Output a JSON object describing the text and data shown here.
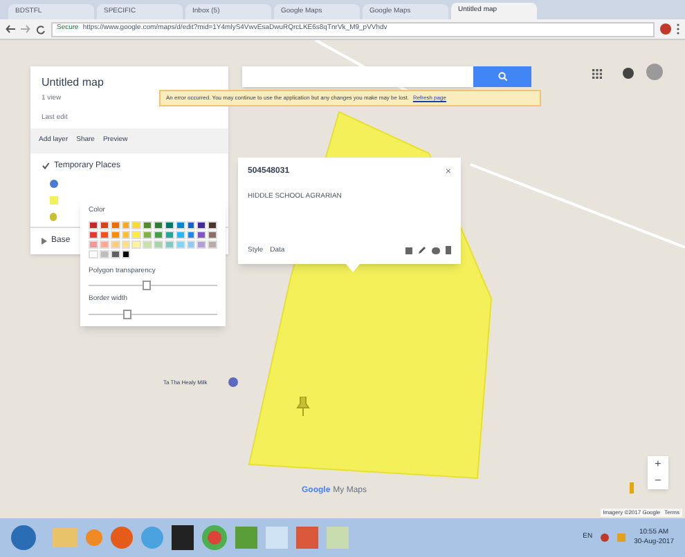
{
  "browser": {
    "tabs": [
      {
        "label": "BDSTFL",
        "selected": false
      },
      {
        "label": "SPECIFIC",
        "selected": false
      },
      {
        "label": "Inbox (5)",
        "selected": false
      },
      {
        "label": "Google Maps",
        "selected": false
      },
      {
        "label": "Google Maps",
        "selected": false
      },
      {
        "label": "Untitled map",
        "selected": true
      }
    ],
    "secure_label": "Secure",
    "url": "https://www.google.com/maps/d/edit?mid=1Y4mlyS4VwvEsaDwuRQrcLKE6s8qTnrVk_M9_pVVhdv"
  },
  "map_panel": {
    "title": "Untitled map",
    "subtitle": "1 view",
    "description": "Last edit",
    "actions": [
      "Add layer",
      "Share",
      "Preview"
    ],
    "layer": {
      "name": "Temporary Places",
      "checked": true
    },
    "base_map": "Base"
  },
  "notice": {
    "text": "An error occurred. You may continue to use the application but any changes you make may be lost.",
    "link": "Refresh page"
  },
  "info_popup": {
    "title": "504548031",
    "description": "HIDDLE SCHOOL AGRARIAN",
    "close": "×",
    "actions": [
      "Style",
      "Data"
    ]
  },
  "style_popup": {
    "heading": "Color",
    "swatches": [
      {
        "color": "#c62828"
      },
      {
        "color": "#d84315"
      },
      {
        "color": "#ef6c00"
      },
      {
        "color": "#f9a825"
      },
      {
        "color": "#fdd835"
      },
      {
        "color": "#558b2f"
      },
      {
        "color": "#2e7d32"
      },
      {
        "color": "#00796b"
      },
      {
        "color": "#0288d1"
      },
      {
        "color": "#1565c0"
      },
      {
        "color": "#4527a0"
      },
      {
        "color": "#4e342e"
      },
      {
        "color": "#e53935"
      },
      {
        "color": "#f4511e"
      },
      {
        "color": "#fb8c00"
      },
      {
        "color": "#fbc02d"
      },
      {
        "color": "#ffeb3b"
      },
      {
        "color": "#7cb342"
      },
      {
        "color": "#43a047"
      },
      {
        "color": "#26a69a"
      },
      {
        "color": "#29b6f6"
      },
      {
        "color": "#1e88e5"
      },
      {
        "color": "#7e57c2"
      },
      {
        "color": "#8d6e63"
      },
      {
        "color": "#ef9a9a"
      },
      {
        "color": "#ffab91"
      },
      {
        "color": "#ffcc80"
      },
      {
        "color": "#ffe082"
      },
      {
        "color": "#fff59d"
      },
      {
        "color": "#c5e1a5"
      },
      {
        "color": "#a5d6a7"
      },
      {
        "color": "#80cbc4"
      },
      {
        "color": "#81d4fa"
      },
      {
        "color": "#90caf9"
      },
      {
        "color": "#b39ddb"
      },
      {
        "color": "#bcaaa4"
      },
      {
        "color": "#ffffff"
      },
      {
        "color": "#bdbdbd"
      },
      {
        "color": "#616161"
      },
      {
        "color": "#000000"
      }
    ],
    "sliders": [
      {
        "label": "Polygon transparency",
        "level": 0.45
      },
      {
        "label": "Border width",
        "level": 0.3
      }
    ]
  },
  "map": {
    "place_label": "Ta Tha Healy Milk",
    "logo_google": "Google",
    "logo_product": "My Maps",
    "attribution": "Imagery ©2017 Google",
    "terms": "Terms",
    "zoom_in": "+",
    "zoom_out": "−"
  },
  "taskbar": {
    "language": "EN",
    "clock_time": "10:55 AM",
    "clock_date": "30-Aug-2017"
  }
}
